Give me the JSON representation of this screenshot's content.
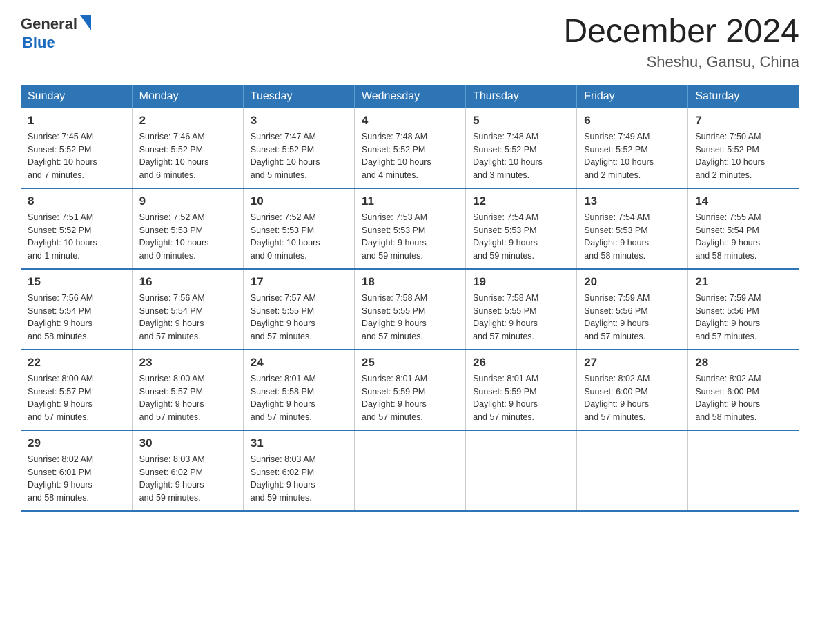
{
  "header": {
    "logo_general": "General",
    "logo_blue": "Blue",
    "month_title": "December 2024",
    "location": "Sheshu, Gansu, China"
  },
  "days_of_week": [
    "Sunday",
    "Monday",
    "Tuesday",
    "Wednesday",
    "Thursday",
    "Friday",
    "Saturday"
  ],
  "weeks": [
    {
      "days": [
        {
          "num": "1",
          "info": "Sunrise: 7:45 AM\nSunset: 5:52 PM\nDaylight: 10 hours\nand 7 minutes."
        },
        {
          "num": "2",
          "info": "Sunrise: 7:46 AM\nSunset: 5:52 PM\nDaylight: 10 hours\nand 6 minutes."
        },
        {
          "num": "3",
          "info": "Sunrise: 7:47 AM\nSunset: 5:52 PM\nDaylight: 10 hours\nand 5 minutes."
        },
        {
          "num": "4",
          "info": "Sunrise: 7:48 AM\nSunset: 5:52 PM\nDaylight: 10 hours\nand 4 minutes."
        },
        {
          "num": "5",
          "info": "Sunrise: 7:48 AM\nSunset: 5:52 PM\nDaylight: 10 hours\nand 3 minutes."
        },
        {
          "num": "6",
          "info": "Sunrise: 7:49 AM\nSunset: 5:52 PM\nDaylight: 10 hours\nand 2 minutes."
        },
        {
          "num": "7",
          "info": "Sunrise: 7:50 AM\nSunset: 5:52 PM\nDaylight: 10 hours\nand 2 minutes."
        }
      ]
    },
    {
      "days": [
        {
          "num": "8",
          "info": "Sunrise: 7:51 AM\nSunset: 5:52 PM\nDaylight: 10 hours\nand 1 minute."
        },
        {
          "num": "9",
          "info": "Sunrise: 7:52 AM\nSunset: 5:53 PM\nDaylight: 10 hours\nand 0 minutes."
        },
        {
          "num": "10",
          "info": "Sunrise: 7:52 AM\nSunset: 5:53 PM\nDaylight: 10 hours\nand 0 minutes."
        },
        {
          "num": "11",
          "info": "Sunrise: 7:53 AM\nSunset: 5:53 PM\nDaylight: 9 hours\nand 59 minutes."
        },
        {
          "num": "12",
          "info": "Sunrise: 7:54 AM\nSunset: 5:53 PM\nDaylight: 9 hours\nand 59 minutes."
        },
        {
          "num": "13",
          "info": "Sunrise: 7:54 AM\nSunset: 5:53 PM\nDaylight: 9 hours\nand 58 minutes."
        },
        {
          "num": "14",
          "info": "Sunrise: 7:55 AM\nSunset: 5:54 PM\nDaylight: 9 hours\nand 58 minutes."
        }
      ]
    },
    {
      "days": [
        {
          "num": "15",
          "info": "Sunrise: 7:56 AM\nSunset: 5:54 PM\nDaylight: 9 hours\nand 58 minutes."
        },
        {
          "num": "16",
          "info": "Sunrise: 7:56 AM\nSunset: 5:54 PM\nDaylight: 9 hours\nand 57 minutes."
        },
        {
          "num": "17",
          "info": "Sunrise: 7:57 AM\nSunset: 5:55 PM\nDaylight: 9 hours\nand 57 minutes."
        },
        {
          "num": "18",
          "info": "Sunrise: 7:58 AM\nSunset: 5:55 PM\nDaylight: 9 hours\nand 57 minutes."
        },
        {
          "num": "19",
          "info": "Sunrise: 7:58 AM\nSunset: 5:55 PM\nDaylight: 9 hours\nand 57 minutes."
        },
        {
          "num": "20",
          "info": "Sunrise: 7:59 AM\nSunset: 5:56 PM\nDaylight: 9 hours\nand 57 minutes."
        },
        {
          "num": "21",
          "info": "Sunrise: 7:59 AM\nSunset: 5:56 PM\nDaylight: 9 hours\nand 57 minutes."
        }
      ]
    },
    {
      "days": [
        {
          "num": "22",
          "info": "Sunrise: 8:00 AM\nSunset: 5:57 PM\nDaylight: 9 hours\nand 57 minutes."
        },
        {
          "num": "23",
          "info": "Sunrise: 8:00 AM\nSunset: 5:57 PM\nDaylight: 9 hours\nand 57 minutes."
        },
        {
          "num": "24",
          "info": "Sunrise: 8:01 AM\nSunset: 5:58 PM\nDaylight: 9 hours\nand 57 minutes."
        },
        {
          "num": "25",
          "info": "Sunrise: 8:01 AM\nSunset: 5:59 PM\nDaylight: 9 hours\nand 57 minutes."
        },
        {
          "num": "26",
          "info": "Sunrise: 8:01 AM\nSunset: 5:59 PM\nDaylight: 9 hours\nand 57 minutes."
        },
        {
          "num": "27",
          "info": "Sunrise: 8:02 AM\nSunset: 6:00 PM\nDaylight: 9 hours\nand 57 minutes."
        },
        {
          "num": "28",
          "info": "Sunrise: 8:02 AM\nSunset: 6:00 PM\nDaylight: 9 hours\nand 58 minutes."
        }
      ]
    },
    {
      "days": [
        {
          "num": "29",
          "info": "Sunrise: 8:02 AM\nSunset: 6:01 PM\nDaylight: 9 hours\nand 58 minutes."
        },
        {
          "num": "30",
          "info": "Sunrise: 8:03 AM\nSunset: 6:02 PM\nDaylight: 9 hours\nand 59 minutes."
        },
        {
          "num": "31",
          "info": "Sunrise: 8:03 AM\nSunset: 6:02 PM\nDaylight: 9 hours\nand 59 minutes."
        },
        {
          "num": "",
          "info": ""
        },
        {
          "num": "",
          "info": ""
        },
        {
          "num": "",
          "info": ""
        },
        {
          "num": "",
          "info": ""
        }
      ]
    }
  ]
}
